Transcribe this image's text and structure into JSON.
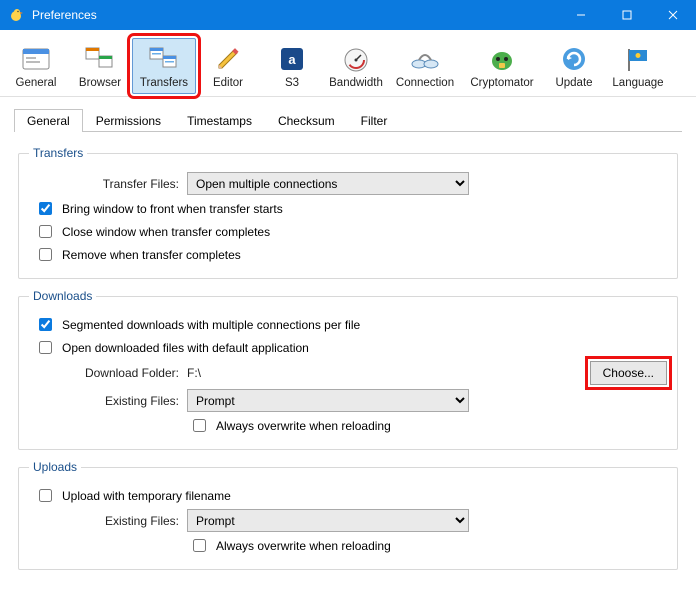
{
  "window": {
    "title": "Preferences"
  },
  "toolbar": {
    "items": [
      {
        "label": "General"
      },
      {
        "label": "Browser"
      },
      {
        "label": "Transfers"
      },
      {
        "label": "Editor"
      },
      {
        "label": "S3"
      },
      {
        "label": "Bandwidth"
      },
      {
        "label": "Connection"
      },
      {
        "label": "Cryptomator"
      },
      {
        "label": "Update"
      },
      {
        "label": "Language"
      }
    ]
  },
  "tabs": {
    "general": "General",
    "permissions": "Permissions",
    "timestamps": "Timestamps",
    "checksum": "Checksum",
    "filter": "Filter"
  },
  "transfers": {
    "legend": "Transfers",
    "transferFilesLabel": "Transfer Files:",
    "transferFilesValue": "Open multiple connections",
    "bringFront": "Bring window to front when transfer starts",
    "closeComplete": "Close window when transfer completes",
    "removeComplete": "Remove when transfer completes"
  },
  "downloads": {
    "legend": "Downloads",
    "segmented": "Segmented downloads with multiple connections per file",
    "openDefault": "Open downloaded files with default application",
    "folderLabel": "Download Folder:",
    "folderValue": "F:\\",
    "choose": "Choose...",
    "existingLabel": "Existing Files:",
    "existingValue": "Prompt",
    "alwaysOverwrite": "Always overwrite when reloading"
  },
  "uploads": {
    "legend": "Uploads",
    "tempFilename": "Upload with temporary filename",
    "existingLabel": "Existing Files:",
    "existingValue": "Prompt",
    "alwaysOverwrite": "Always overwrite when reloading"
  }
}
